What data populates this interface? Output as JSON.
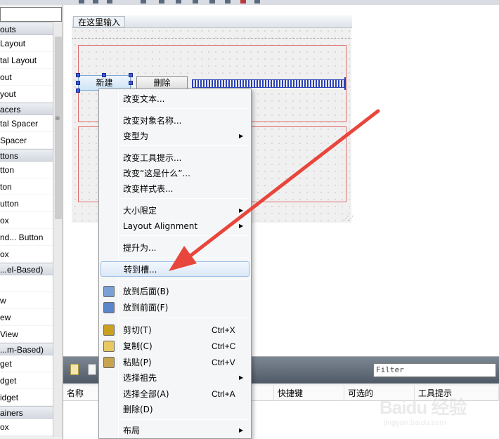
{
  "widget_box": {
    "entries": [
      {
        "kind": "cat",
        "label": "outs"
      },
      {
        "kind": "item",
        "label": " Layout"
      },
      {
        "kind": "item",
        "label": "tal Layout"
      },
      {
        "kind": "item",
        "label": "out"
      },
      {
        "kind": "item",
        "label": "yout"
      },
      {
        "kind": "cat",
        "label": "acers"
      },
      {
        "kind": "item",
        "label": "tal Spacer"
      },
      {
        "kind": "item",
        "label": " Spacer"
      },
      {
        "kind": "cat",
        "label": "ttons"
      },
      {
        "kind": "item",
        "label": "tton"
      },
      {
        "kind": "item",
        "label": "ton"
      },
      {
        "kind": "item",
        "label": "utton"
      },
      {
        "kind": "item",
        "label": "ox"
      },
      {
        "kind": "item",
        "label": "nd... Button"
      },
      {
        "kind": "item",
        "label": "ox"
      },
      {
        "kind": "cat",
        "label": "...el-Based)"
      },
      {
        "kind": "item",
        "label": ""
      },
      {
        "kind": "item",
        "label": "w"
      },
      {
        "kind": "item",
        "label": "ew"
      },
      {
        "kind": "item",
        "label": "View"
      },
      {
        "kind": "cat",
        "label": "...m-Based)"
      },
      {
        "kind": "item",
        "label": "get"
      },
      {
        "kind": "item",
        "label": "dget"
      },
      {
        "kind": "item",
        "label": "idget"
      },
      {
        "kind": "cat",
        "label": "ainers"
      },
      {
        "kind": "item",
        "label": "ox"
      }
    ]
  },
  "form": {
    "menu_item": "在这里输入",
    "btn_new": "新建",
    "btn_delete": "删除"
  },
  "context_menu": {
    "items": [
      {
        "label": "改变文本...",
        "top": 0
      },
      {
        "label": "改变对象名称...",
        "arrow": false
      },
      {
        "label": "变型为",
        "arrow": true
      },
      {
        "label": "改变工具提示..."
      },
      {
        "label": "改变“这是什么”..."
      },
      {
        "label": "改变样式表..."
      },
      {
        "label": "大小限定",
        "arrow": true
      },
      {
        "label": "Layout Alignment",
        "arrow": true
      },
      {
        "label": "提升为..."
      },
      {
        "label": "转到槽...",
        "highlight": true
      },
      {
        "label": "放到后面(B)",
        "icon": "send-back-icon"
      },
      {
        "label": "放到前面(F)",
        "icon": "bring-front-icon"
      },
      {
        "label": "剪切(T)",
        "shortcut": "Ctrl+X",
        "icon": "scissors-icon"
      },
      {
        "label": "复制(C)",
        "shortcut": "Ctrl+C",
        "icon": "copy-icon"
      },
      {
        "label": "粘贴(P)",
        "shortcut": "Ctrl+V",
        "icon": "paste-icon"
      },
      {
        "label": "选择祖先",
        "arrow": true
      },
      {
        "label": "选择全部(A)",
        "shortcut": "Ctrl+A"
      },
      {
        "label": "删除(D)"
      },
      {
        "label": "布局",
        "arrow": true
      }
    ]
  },
  "action_editor": {
    "filter_placeholder": "Filter",
    "columns": [
      "名称",
      "快捷键",
      "可选的",
      "工具提示"
    ]
  },
  "watermark": {
    "text": "Baidu 经验",
    "sub": "jingyan.baidu.com"
  },
  "colors": {
    "arrow": "#e8463c",
    "layout_border": "#e06a6a",
    "spacer": "#2a40b8",
    "highlight": "#dbe8f7"
  }
}
